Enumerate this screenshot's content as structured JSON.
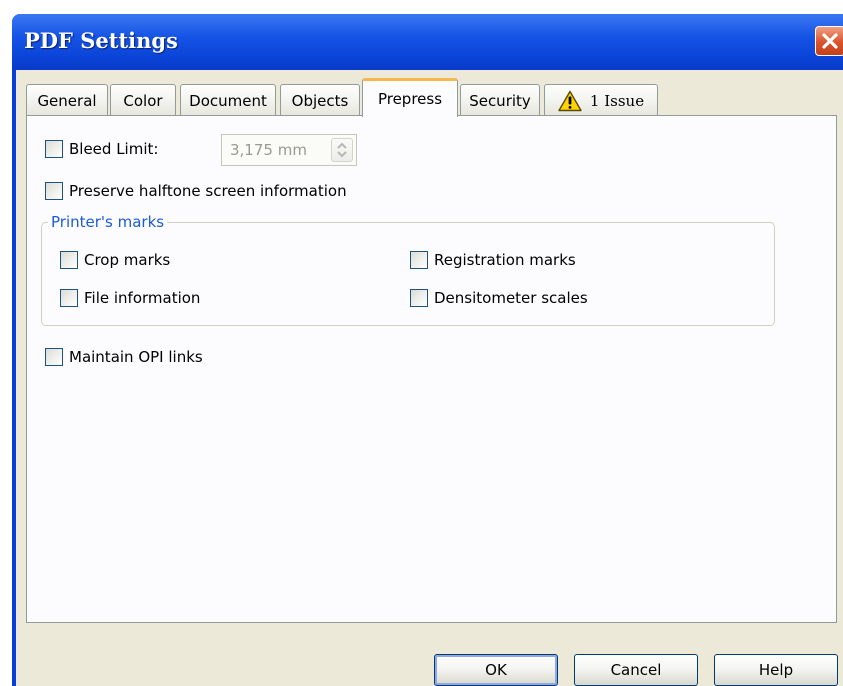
{
  "window": {
    "title": "PDF Settings"
  },
  "tabs": [
    {
      "label": "General"
    },
    {
      "label": "Color"
    },
    {
      "label": "Document"
    },
    {
      "label": "Objects"
    },
    {
      "label": "Prepress",
      "active": true
    },
    {
      "label": "Security"
    },
    {
      "label": "1 Issue",
      "icon": "warning-icon"
    }
  ],
  "prepress": {
    "bleed_limit": {
      "label": "Bleed Limit:",
      "checked": false,
      "value": "3,175 mm"
    },
    "preserve_halftone": {
      "label": "Preserve halftone screen information",
      "checked": false
    },
    "printers_marks": {
      "title": "Printer's marks",
      "crop_marks": "Crop marks",
      "registration_marks": "Registration marks",
      "file_information": "File information",
      "densitometer_scales": "Densitometer scales"
    },
    "maintain_opi": {
      "label": "Maintain OPI links",
      "checked": false
    }
  },
  "buttons": {
    "ok": "OK",
    "cancel": "Cancel",
    "help": "Help"
  },
  "colors": {
    "titlebar": "#0b45d9",
    "close": "#d9542a",
    "active_tab_accent": "#f7b74c",
    "group_title": "#1d5ad6"
  }
}
